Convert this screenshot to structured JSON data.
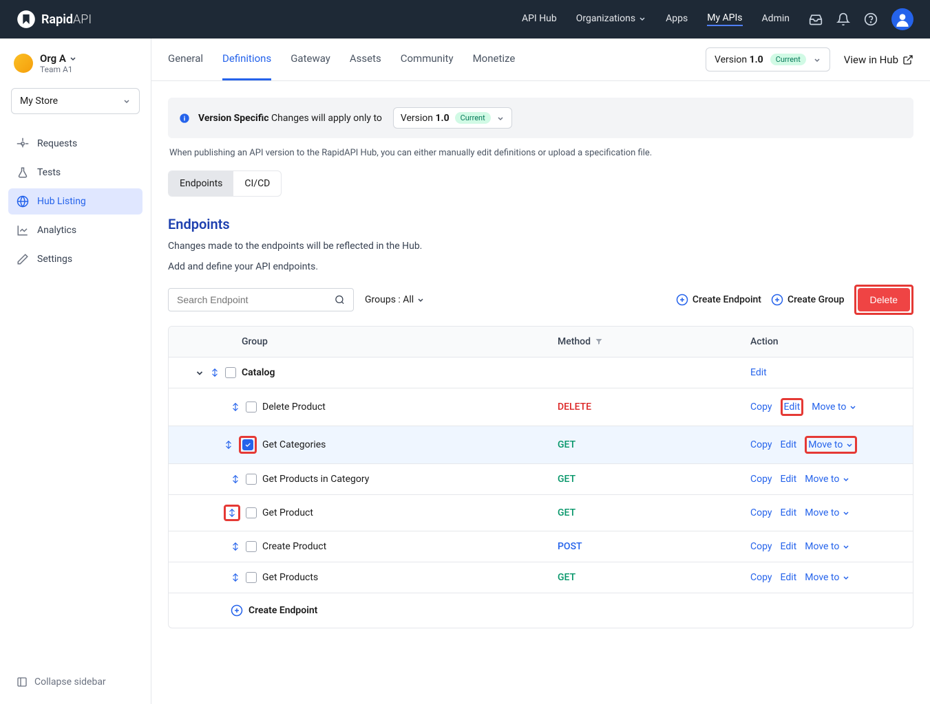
{
  "header": {
    "brand": "Rapid",
    "brand_suffix": "API",
    "nav": [
      "API Hub",
      "Organizations",
      "Apps",
      "My APIs",
      "Admin"
    ],
    "nav_active": "My APIs"
  },
  "sidebar": {
    "org_name": "Org A",
    "team_name": "Team A1",
    "store_label": "My Store",
    "items": [
      {
        "label": "Requests"
      },
      {
        "label": "Tests"
      },
      {
        "label": "Hub Listing"
      },
      {
        "label": "Analytics"
      },
      {
        "label": "Settings"
      }
    ],
    "active_index": 2,
    "collapse_label": "Collapse sidebar"
  },
  "tabs": {
    "items": [
      "General",
      "Definitions",
      "Gateway",
      "Assets",
      "Community",
      "Monetize"
    ],
    "active": "Definitions",
    "version_prefix": "Version",
    "version_value": "1.0",
    "current_badge": "Current",
    "view_hub": "View in Hub"
  },
  "banner": {
    "title": "Version Specific",
    "text": "Changes will apply only to",
    "version_prefix": "Version",
    "version_value": "1.0",
    "current_badge": "Current"
  },
  "desc": "When publishing an API version to the RapidAPI Hub, you can either manually edit definitions or upload a specification file.",
  "sub_tabs": {
    "items": [
      "Endpoints",
      "CI/CD"
    ],
    "active": "Endpoints"
  },
  "section": {
    "title": "Endpoints",
    "desc": "Changes made to the endpoints will be reflected in the Hub.",
    "subdesc": "Add and define your API endpoints."
  },
  "toolbar": {
    "search_placeholder": "Search Endpoint",
    "groups_label": "Groups : All",
    "create_endpoint": "Create Endpoint",
    "create_group": "Create Group",
    "delete": "Delete"
  },
  "table": {
    "headers": {
      "group": "Group",
      "method": "Method",
      "action": "Action"
    },
    "group_name": "Catalog",
    "group_action": "Edit",
    "actions": {
      "copy": "Copy",
      "edit": "Edit",
      "move": "Move to"
    },
    "rows": [
      {
        "name": "Delete Product",
        "method": "DELETE",
        "selected": false,
        "highlight_edit": true
      },
      {
        "name": "Get Categories",
        "method": "GET",
        "selected": true,
        "highlight_checkbox": true,
        "highlight_move": true
      },
      {
        "name": "Get Products in Category",
        "method": "GET",
        "selected": false
      },
      {
        "name": "Get Product",
        "method": "GET",
        "selected": false,
        "highlight_drag": true
      },
      {
        "name": "Create Product",
        "method": "POST",
        "selected": false
      },
      {
        "name": "Get Products",
        "method": "GET",
        "selected": false
      }
    ],
    "create_endpoint_label": "Create Endpoint"
  }
}
